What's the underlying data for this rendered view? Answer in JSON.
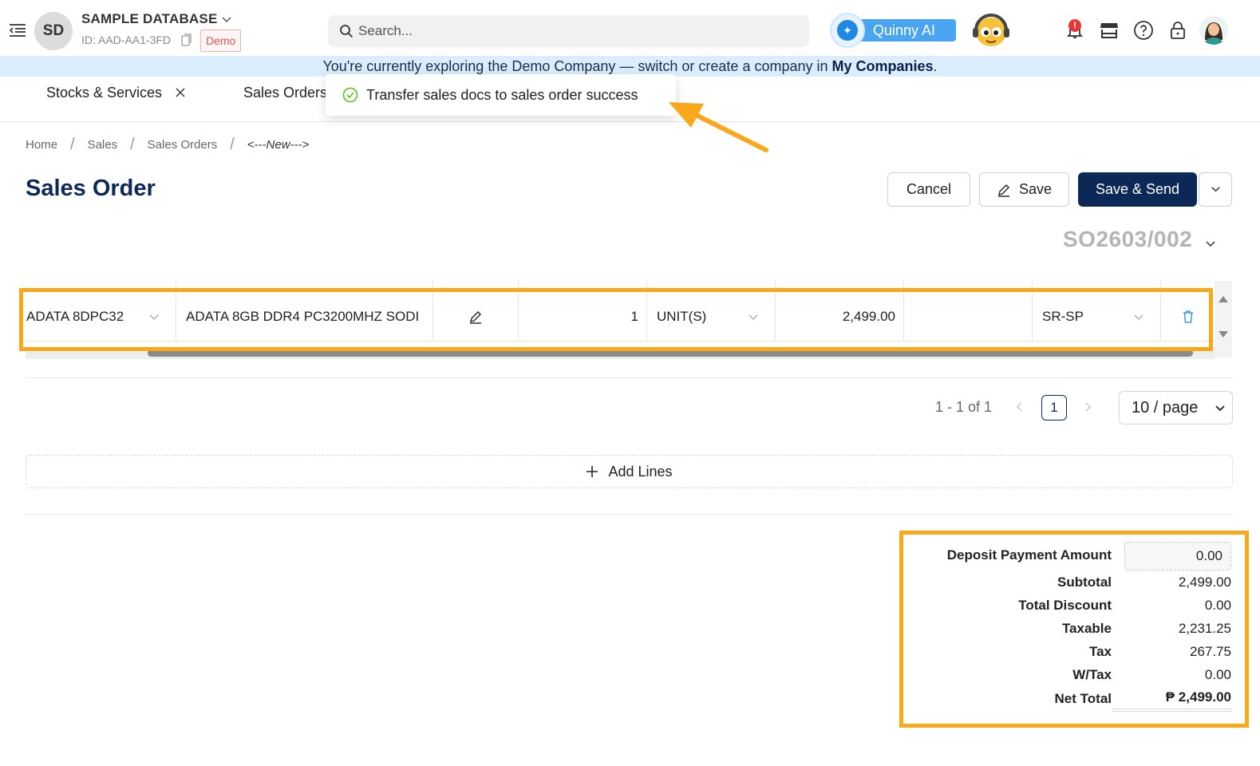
{
  "header": {
    "avatar_initials": "SD",
    "database_name": "SAMPLE DATABASE",
    "database_id": "ID: AAD-AA1-3FD",
    "demo_badge": "Demo",
    "search_placeholder": "Search...",
    "ai_label": "Quinny AI",
    "notification_count": "!"
  },
  "demo_banner": {
    "text": "You're currently exploring the Demo Company — switch or create a company in ",
    "link": "My Companies",
    "suffix": "."
  },
  "tabs": [
    {
      "label": "Stocks & Services"
    },
    {
      "label": "Sales Orders"
    }
  ],
  "toast": {
    "message": "Transfer sales docs to sales order success"
  },
  "breadcrumb": [
    "Home",
    "Sales",
    "Sales Orders",
    "<---New--->"
  ],
  "page": {
    "title": "Sales Order",
    "doc_number": "SO2603/002"
  },
  "actions": {
    "cancel": "Cancel",
    "save": "Save",
    "save_send": "Save & Send"
  },
  "line": {
    "item_code": "ADATA 8DPC32",
    "description": "ADATA 8GB DDR4 PC3200MHZ SODI",
    "quantity": "1",
    "uom": "UNIT(S)",
    "unit_price": "2,499.00",
    "discount": "",
    "tax_code": "SR-SP"
  },
  "pagination": {
    "range": "1 - 1 of 1",
    "current_page": "1",
    "page_size": "10 / page"
  },
  "add_lines": "Add Lines",
  "totals": {
    "deposit_label": "Deposit Payment Amount",
    "deposit_value": "0.00",
    "subtotal_label": "Subtotal",
    "subtotal_value": "2,499.00",
    "discount_label": "Total Discount",
    "discount_value": "0.00",
    "taxable_label": "Taxable",
    "taxable_value": "2,231.25",
    "tax_label": "Tax",
    "tax_value": "267.75",
    "wtax_label": "W/Tax",
    "wtax_value": "0.00",
    "net_label": "Net Total",
    "net_value": "₱ 2,499.00"
  },
  "colors": {
    "primary": "#0b2857",
    "highlight": "#f7a81b",
    "banner": "#d9edfc",
    "success": "#52c41a"
  }
}
